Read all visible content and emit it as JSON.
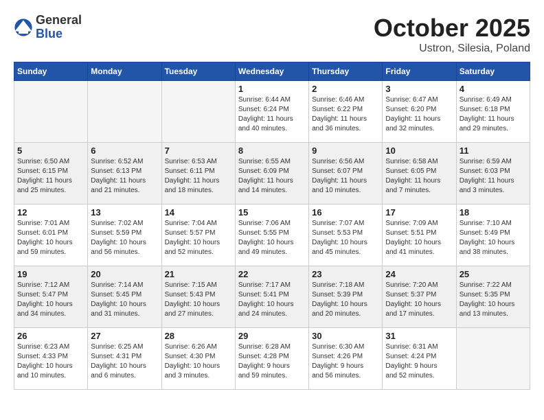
{
  "header": {
    "logo_general": "General",
    "logo_blue": "Blue",
    "month_title": "October 2025",
    "location": "Ustron, Silesia, Poland"
  },
  "weekdays": [
    "Sunday",
    "Monday",
    "Tuesday",
    "Wednesday",
    "Thursday",
    "Friday",
    "Saturday"
  ],
  "weeks": [
    {
      "shaded": false,
      "days": [
        {
          "num": "",
          "info": ""
        },
        {
          "num": "",
          "info": ""
        },
        {
          "num": "",
          "info": ""
        },
        {
          "num": "1",
          "info": "Sunrise: 6:44 AM\nSunset: 6:24 PM\nDaylight: 11 hours\nand 40 minutes."
        },
        {
          "num": "2",
          "info": "Sunrise: 6:46 AM\nSunset: 6:22 PM\nDaylight: 11 hours\nand 36 minutes."
        },
        {
          "num": "3",
          "info": "Sunrise: 6:47 AM\nSunset: 6:20 PM\nDaylight: 11 hours\nand 32 minutes."
        },
        {
          "num": "4",
          "info": "Sunrise: 6:49 AM\nSunset: 6:18 PM\nDaylight: 11 hours\nand 29 minutes."
        }
      ]
    },
    {
      "shaded": true,
      "days": [
        {
          "num": "5",
          "info": "Sunrise: 6:50 AM\nSunset: 6:15 PM\nDaylight: 11 hours\nand 25 minutes."
        },
        {
          "num": "6",
          "info": "Sunrise: 6:52 AM\nSunset: 6:13 PM\nDaylight: 11 hours\nand 21 minutes."
        },
        {
          "num": "7",
          "info": "Sunrise: 6:53 AM\nSunset: 6:11 PM\nDaylight: 11 hours\nand 18 minutes."
        },
        {
          "num": "8",
          "info": "Sunrise: 6:55 AM\nSunset: 6:09 PM\nDaylight: 11 hours\nand 14 minutes."
        },
        {
          "num": "9",
          "info": "Sunrise: 6:56 AM\nSunset: 6:07 PM\nDaylight: 11 hours\nand 10 minutes."
        },
        {
          "num": "10",
          "info": "Sunrise: 6:58 AM\nSunset: 6:05 PM\nDaylight: 11 hours\nand 7 minutes."
        },
        {
          "num": "11",
          "info": "Sunrise: 6:59 AM\nSunset: 6:03 PM\nDaylight: 11 hours\nand 3 minutes."
        }
      ]
    },
    {
      "shaded": false,
      "days": [
        {
          "num": "12",
          "info": "Sunrise: 7:01 AM\nSunset: 6:01 PM\nDaylight: 10 hours\nand 59 minutes."
        },
        {
          "num": "13",
          "info": "Sunrise: 7:02 AM\nSunset: 5:59 PM\nDaylight: 10 hours\nand 56 minutes."
        },
        {
          "num": "14",
          "info": "Sunrise: 7:04 AM\nSunset: 5:57 PM\nDaylight: 10 hours\nand 52 minutes."
        },
        {
          "num": "15",
          "info": "Sunrise: 7:06 AM\nSunset: 5:55 PM\nDaylight: 10 hours\nand 49 minutes."
        },
        {
          "num": "16",
          "info": "Sunrise: 7:07 AM\nSunset: 5:53 PM\nDaylight: 10 hours\nand 45 minutes."
        },
        {
          "num": "17",
          "info": "Sunrise: 7:09 AM\nSunset: 5:51 PM\nDaylight: 10 hours\nand 41 minutes."
        },
        {
          "num": "18",
          "info": "Sunrise: 7:10 AM\nSunset: 5:49 PM\nDaylight: 10 hours\nand 38 minutes."
        }
      ]
    },
    {
      "shaded": true,
      "days": [
        {
          "num": "19",
          "info": "Sunrise: 7:12 AM\nSunset: 5:47 PM\nDaylight: 10 hours\nand 34 minutes."
        },
        {
          "num": "20",
          "info": "Sunrise: 7:14 AM\nSunset: 5:45 PM\nDaylight: 10 hours\nand 31 minutes."
        },
        {
          "num": "21",
          "info": "Sunrise: 7:15 AM\nSunset: 5:43 PM\nDaylight: 10 hours\nand 27 minutes."
        },
        {
          "num": "22",
          "info": "Sunrise: 7:17 AM\nSunset: 5:41 PM\nDaylight: 10 hours\nand 24 minutes."
        },
        {
          "num": "23",
          "info": "Sunrise: 7:18 AM\nSunset: 5:39 PM\nDaylight: 10 hours\nand 20 minutes."
        },
        {
          "num": "24",
          "info": "Sunrise: 7:20 AM\nSunset: 5:37 PM\nDaylight: 10 hours\nand 17 minutes."
        },
        {
          "num": "25",
          "info": "Sunrise: 7:22 AM\nSunset: 5:35 PM\nDaylight: 10 hours\nand 13 minutes."
        }
      ]
    },
    {
      "shaded": false,
      "days": [
        {
          "num": "26",
          "info": "Sunrise: 6:23 AM\nSunset: 4:33 PM\nDaylight: 10 hours\nand 10 minutes."
        },
        {
          "num": "27",
          "info": "Sunrise: 6:25 AM\nSunset: 4:31 PM\nDaylight: 10 hours\nand 6 minutes."
        },
        {
          "num": "28",
          "info": "Sunrise: 6:26 AM\nSunset: 4:30 PM\nDaylight: 10 hours\nand 3 minutes."
        },
        {
          "num": "29",
          "info": "Sunrise: 6:28 AM\nSunset: 4:28 PM\nDaylight: 9 hours\nand 59 minutes."
        },
        {
          "num": "30",
          "info": "Sunrise: 6:30 AM\nSunset: 4:26 PM\nDaylight: 9 hours\nand 56 minutes."
        },
        {
          "num": "31",
          "info": "Sunrise: 6:31 AM\nSunset: 4:24 PM\nDaylight: 9 hours\nand 52 minutes."
        },
        {
          "num": "",
          "info": ""
        }
      ]
    }
  ]
}
